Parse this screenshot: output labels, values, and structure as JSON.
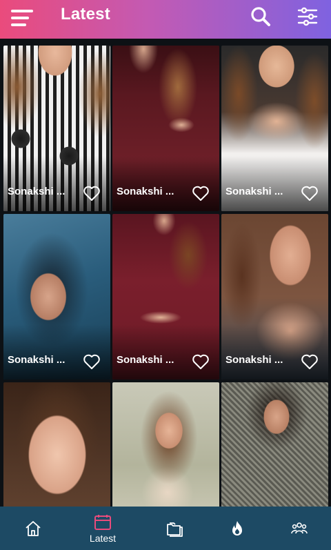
{
  "header": {
    "title": "Latest",
    "menu_icon": "hamburger-menu-icon",
    "search_icon": "search-icon",
    "filter_icon": "sliders-icon"
  },
  "grid": {
    "items": [
      {
        "name": "Sonakshi ..."
      },
      {
        "name": "Sonakshi ..."
      },
      {
        "name": "Sonakshi ..."
      },
      {
        "name": "Sonakshi ..."
      },
      {
        "name": "Sonakshi ..."
      },
      {
        "name": "Sonakshi ..."
      },
      {
        "name": "",
        "partial": true
      },
      {
        "name": "",
        "partial": true
      },
      {
        "name": "",
        "partial": true
      }
    ]
  },
  "bottom_nav": {
    "items": [
      {
        "icon": "home-icon",
        "label": ""
      },
      {
        "icon": "calendar-icon",
        "label": "Latest",
        "active": true
      },
      {
        "icon": "folders-icon",
        "label": ""
      },
      {
        "icon": "fire-icon",
        "label": ""
      },
      {
        "icon": "group-icon",
        "label": ""
      }
    ]
  },
  "colors": {
    "header_start": "#ea4b7c",
    "header_end": "#7f62e0",
    "background": "#0d1115",
    "nav_background": "#1d4a64",
    "nav_active": "#ea4b7c"
  }
}
